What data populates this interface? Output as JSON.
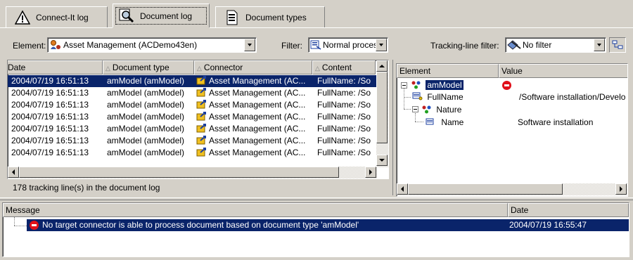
{
  "tabs": [
    {
      "label": "Connect-It log",
      "icon": "warning-icon",
      "active": false
    },
    {
      "label": "Document log",
      "icon": "magnifier-icon",
      "active": true
    },
    {
      "label": "Document types",
      "icon": "document-icon",
      "active": false
    }
  ],
  "filters": {
    "element_label": "Element:",
    "element_value": "Asset Management (ACDemo43en)",
    "filter_label": "Filter:",
    "filter_value": "Normal proces",
    "tracking_label": "Tracking-line filter:",
    "tracking_value": "No filter"
  },
  "doc_log": {
    "columns": [
      "Date",
      "Document type",
      "Connector",
      "Content"
    ],
    "rows": [
      {
        "date": "2004/07/19 16:51:13",
        "type": "amModel (amModel)",
        "connector": "Asset Management (AC...",
        "content": "FullName: /So",
        "selected": true
      },
      {
        "date": "2004/07/19 16:51:13",
        "type": "amModel (amModel)",
        "connector": "Asset Management (AC...",
        "content": "FullName: /So",
        "selected": false
      },
      {
        "date": "2004/07/19 16:51:13",
        "type": "amModel (amModel)",
        "connector": "Asset Management (AC...",
        "content": "FullName: /So",
        "selected": false
      },
      {
        "date": "2004/07/19 16:51:13",
        "type": "amModel (amModel)",
        "connector": "Asset Management (AC...",
        "content": "FullName: /So",
        "selected": false
      },
      {
        "date": "2004/07/19 16:51:13",
        "type": "amModel (amModel)",
        "connector": "Asset Management (AC...",
        "content": "FullName: /So",
        "selected": false
      },
      {
        "date": "2004/07/19 16:51:13",
        "type": "amModel (amModel)",
        "connector": "Asset Management (AC...",
        "content": "FullName: /So",
        "selected": false
      },
      {
        "date": "2004/07/19 16:51:13",
        "type": "amModel (amModel)",
        "connector": "Asset Management (AC...",
        "content": "FullName: /So",
        "selected": false
      }
    ],
    "status": "178 tracking line(s) in the document log"
  },
  "tree": {
    "columns": [
      "Element",
      "Value"
    ],
    "nodes": [
      {
        "label": "amModel",
        "value": "",
        "icon": "structure-icon",
        "selected": true
      },
      {
        "label": "FullName",
        "value": "/Software installation/Develo",
        "icon": "field-key-icon"
      },
      {
        "label": "Nature",
        "value": "",
        "icon": "structure-icon"
      },
      {
        "label": "Name",
        "value": "Software installation",
        "icon": "field-icon"
      }
    ]
  },
  "messages": {
    "columns": [
      "Message",
      "Date"
    ],
    "rows": [
      {
        "text": "No target connector is able to process document based on document type 'amModel'",
        "date": "2004/07/19 16:55:47",
        "selected": true
      }
    ]
  }
}
